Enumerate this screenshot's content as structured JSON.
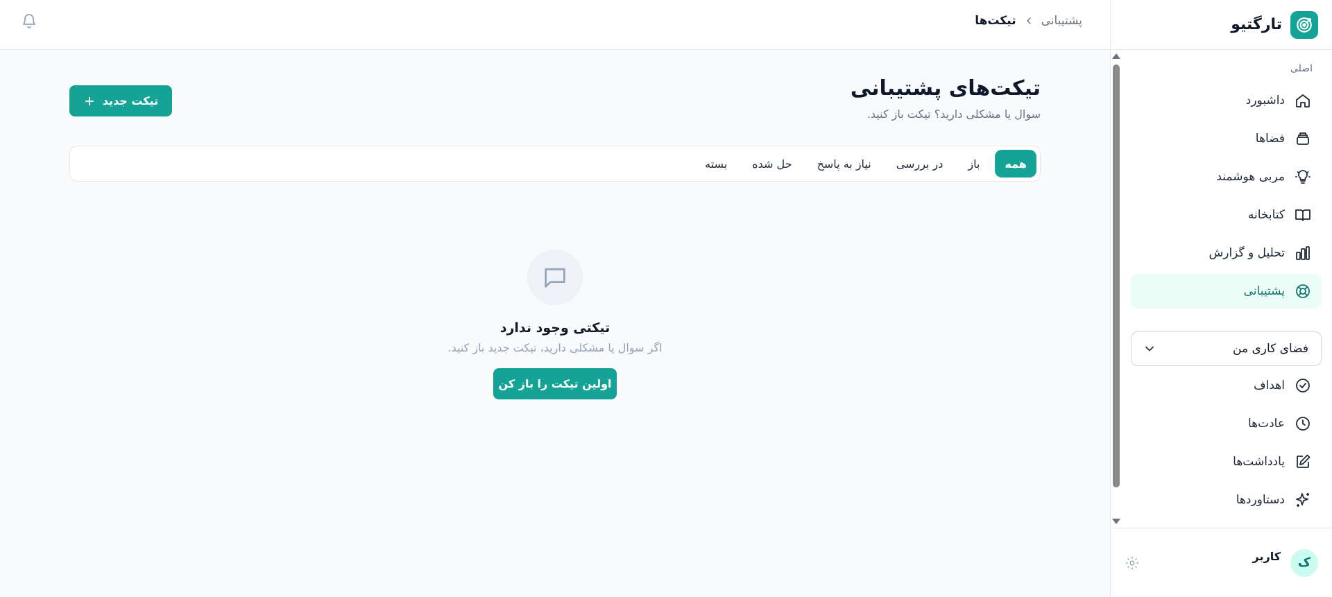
{
  "brand": {
    "name": "تارگتیو"
  },
  "topbar": {
    "breadcrumb": {
      "parent": "پشتیبانی",
      "current": "تیکت‌ها"
    }
  },
  "sidebar": {
    "section_label": "اصلی",
    "items": [
      {
        "label": "داشبورد",
        "icon": "home-icon"
      },
      {
        "label": "فضاها",
        "icon": "layers-icon"
      },
      {
        "label": "مربی هوشمند",
        "icon": "lightbulb-icon"
      },
      {
        "label": "کتابخانه",
        "icon": "book-icon"
      },
      {
        "label": "تحلیل و گزارش",
        "icon": "bar-chart-icon"
      },
      {
        "label": "پشتیبانی",
        "icon": "lifebuoy-icon",
        "active": true
      }
    ],
    "workspace_select": {
      "value": "فضای کاری من"
    },
    "workspace_items": [
      {
        "label": "اهداف",
        "icon": "check-circle-icon"
      },
      {
        "label": "عادت‌ها",
        "icon": "clock-icon"
      },
      {
        "label": "یادداشت‌ها",
        "icon": "edit-icon"
      },
      {
        "label": "دستاوردها",
        "icon": "sparkles-icon"
      }
    ],
    "user": {
      "initial": "ک",
      "name": "کاربر"
    }
  },
  "main": {
    "title": "تیکت‌های پشتیبانی",
    "subtitle": "سوال یا مشکلی دارید؟ تیکت باز کنید.",
    "new_ticket_label": "تیکت جدید",
    "tabs": [
      {
        "label": "همه",
        "active": true
      },
      {
        "label": "باز"
      },
      {
        "label": "در بررسی"
      },
      {
        "label": "نیاز به پاسخ"
      },
      {
        "label": "حل شده"
      },
      {
        "label": "بسته"
      }
    ],
    "empty": {
      "title": "تیکتی وجود ندارد",
      "description": "اگر سوال یا مشکلی دارید، تیکت جدید باز کنید.",
      "cta_label": "اولین تیکت را باز کن"
    }
  },
  "colors": {
    "accent": "#14a394",
    "active_bg": "#ecfdf8",
    "active_text": "#0f766e"
  }
}
